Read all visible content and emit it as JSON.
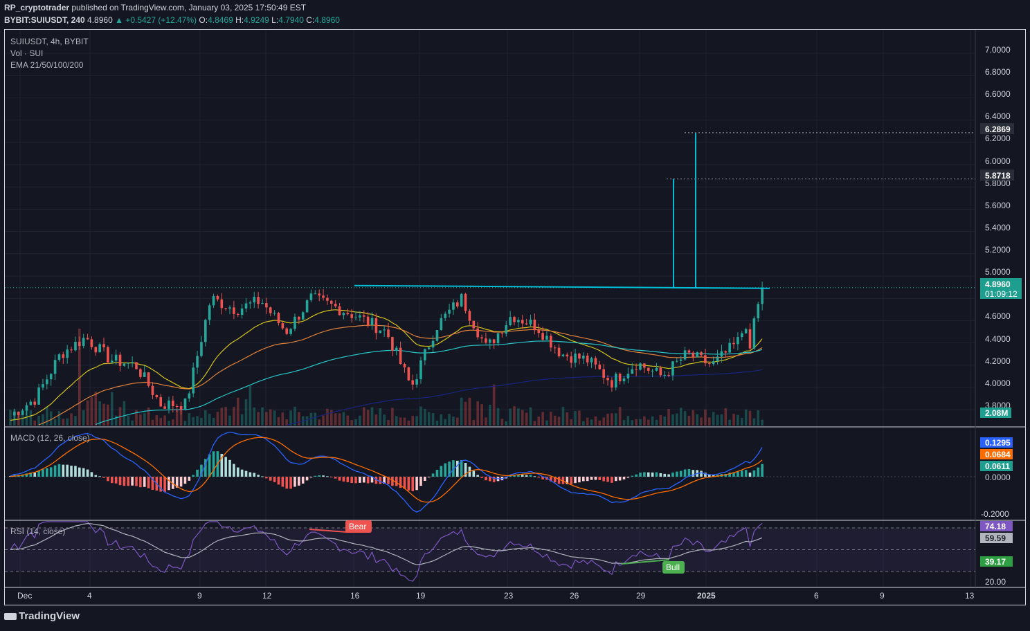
{
  "header": {
    "author": "RP_cryptotrader",
    "published": "published on TradingView.com, January 03, 2025 17:50:49 EST",
    "symbol": "BYBIT:SUIUSDT, 240",
    "last": "4.8960",
    "change": "▲ +0.5427 (+12.47%)",
    "o_label": "O:",
    "o": "4.8469",
    "h_label": "H:",
    "h": "4.9249",
    "l_label": "L:",
    "l": "4.7940",
    "c_label": "C:",
    "c": "4.8960"
  },
  "legend": {
    "main": "SUIUSDT, 4h, BYBIT",
    "vol": "Vol · SUI",
    "ema": "EMA 21/50/100/200",
    "macd": "MACD (12, 26, close)",
    "rsi": "RSI (14, close)"
  },
  "price_axis": [
    "7.0000",
    "6.8000",
    "6.6000",
    "6.4000",
    "6.2000",
    "6.0000",
    "5.8000",
    "5.6000",
    "5.4000",
    "5.2000",
    "5.0000",
    "4.6000",
    "4.4000",
    "4.2000",
    "4.0000",
    "3.8000"
  ],
  "price_badges": {
    "target1": "6.2869",
    "target2": "5.8718",
    "last": "4.8960",
    "countdown": "01:09:12",
    "volume": "2.08M"
  },
  "macd_badges": {
    "macd": "0.1295",
    "signal": "0.0684",
    "hist": "0.0611",
    "zero": "0.0000",
    "low": "-0.2000"
  },
  "rsi_badges": {
    "rsi": "74.18",
    "ma": "59.59",
    "low": "39.17",
    "axis": "20.00"
  },
  "signals": {
    "bear": "Bear",
    "bull": "Bull"
  },
  "x_axis": [
    "Dec",
    "4",
    "9",
    "12",
    "16",
    "19",
    "23",
    "26",
    "29",
    "2025",
    "6",
    "9",
    "13"
  ],
  "footer": {
    "brand": "TradingView"
  },
  "colors": {
    "bg": "#141722",
    "up": "#26a69a",
    "down": "#ef5350",
    "cyan": "#00bcd4",
    "ema21": "#d4c21c",
    "ema50": "#e0803a",
    "ema100": "#26c6c8",
    "ema200": "#1a237e",
    "macd": "#2962ff",
    "signal": "#ff6d00",
    "rsi": "#7e57c2"
  },
  "chart_data": [
    {
      "type": "candlestick",
      "title": "SUIUSDT, 4h, BYBIT",
      "ylim": [
        3.7,
        7.1
      ],
      "last_price": 4.896,
      "resistance_level": 4.89,
      "measured_move_targets": [
        5.8718,
        6.2869
      ],
      "close_path": [
        [
          "Dec 1",
          3.75
        ],
        [
          "Dec 3",
          3.9
        ],
        [
          "Dec 5",
          4.3
        ],
        [
          "Dec 6",
          4.45
        ],
        [
          "Dec 7",
          4.25
        ],
        [
          "Dec 9",
          4.2
        ],
        [
          "Dec 10",
          3.85
        ],
        [
          "Dec 11",
          3.85
        ],
        [
          "Dec 12",
          4.8
        ],
        [
          "Dec 13",
          4.7
        ],
        [
          "Dec 14",
          4.78
        ],
        [
          "Dec 15",
          4.5
        ],
        [
          "Dec 16",
          4.8
        ],
        [
          "Dec 17",
          4.72
        ],
        [
          "Dec 18",
          4.62
        ],
        [
          "Dec 19",
          4.5
        ],
        [
          "Dec 20",
          4.0
        ],
        [
          "Dec 21",
          4.55
        ],
        [
          "Dec 22",
          4.8
        ],
        [
          "Dec 23",
          4.35
        ],
        [
          "Dec 24",
          4.65
        ],
        [
          "Dec 25",
          4.55
        ],
        [
          "Dec 26",
          4.3
        ],
        [
          "Dec 27",
          4.25
        ],
        [
          "Dec 28",
          4.05
        ],
        [
          "Dec 29",
          4.22
        ],
        [
          "Dec 30",
          4.1
        ],
        [
          "Dec 31",
          4.3
        ],
        [
          "Jan 1",
          4.2
        ],
        [
          "Jan 2",
          4.4
        ],
        [
          "Jan 3",
          4.896
        ]
      ]
    },
    {
      "type": "line",
      "title": "MACD (12, 26, close)",
      "ylim": [
        -0.22,
        0.32
      ],
      "series": [
        {
          "name": "MACD",
          "last": 0.1295
        },
        {
          "name": "Signal",
          "last": 0.0684
        },
        {
          "name": "Histogram",
          "last": 0.0611
        }
      ]
    },
    {
      "type": "line",
      "title": "RSI (14, close)",
      "ylim": [
        20,
        80
      ],
      "series": [
        {
          "name": "RSI",
          "last": 74.18
        },
        {
          "name": "RSI MA",
          "last": 59.59
        }
      ],
      "bands": [
        30,
        50,
        70
      ]
    }
  ]
}
